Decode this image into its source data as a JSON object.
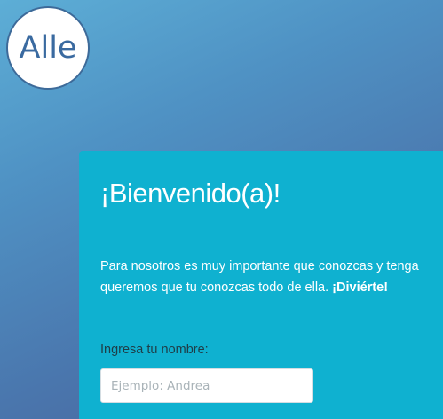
{
  "brand": {
    "logo_text": "Alle"
  },
  "welcome": {
    "title": "¡Bienvenido(a)!",
    "intro_line1": "Para nosotros es muy importante que conozcas y tenga",
    "intro_line2": "queremos que tu conozcas todo de ella. ",
    "intro_emphasis": "¡Diviérte!"
  },
  "form": {
    "name_label": "Ingresa tu nombre:",
    "name_placeholder": "Ejemplo: Andrea",
    "name_value": ""
  },
  "colors": {
    "card_background": "#0fb1d0",
    "logo_text": "#3a6aa0",
    "page_gradient_start": "#5daed6",
    "page_gradient_end": "#4b5f96"
  }
}
